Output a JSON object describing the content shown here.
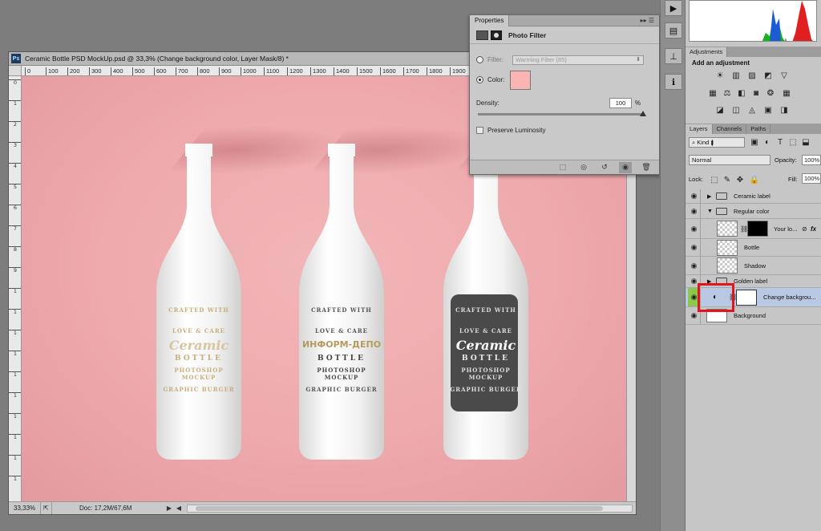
{
  "document": {
    "title": "Ceramic Bottle PSD MockUp.psd @ 33,3% (Change background color, Layer Mask/8) *",
    "ruler_ticks": [
      "0",
      "100",
      "200",
      "300",
      "400",
      "500",
      "600",
      "700",
      "800",
      "900",
      "1000",
      "1100",
      "1200",
      "1300",
      "1400",
      "1500",
      "1600",
      "1700",
      "1800",
      "1900",
      "200"
    ],
    "zoom": "33,33%",
    "doc_info": "Doc: 17,2M/67,6M"
  },
  "bottles": [
    {
      "line1": "CRAFTED WITH",
      "line2": "LOVE & CARE",
      "main": "Ceramic",
      "mid": "BOTTLE",
      "sub1": "PHOTOSHOP",
      "sub2": "MOCKUP",
      "footer": "GRAPHIC BURGER"
    },
    {
      "line1": "CRAFTED WITH",
      "line2": "LOVE & CARE",
      "main": "ИНФОРМ-ДЕПО",
      "mid": "BOTTLE",
      "sub1": "PHOTOSHOP",
      "sub2": "MOCKUP",
      "footer": "GRAPHIC BURGER"
    },
    {
      "line1": "CRAFTED WITH",
      "line2": "LOVE & CARE",
      "main": "Ceramic",
      "mid": "BOTTLE",
      "sub1": "PHOTOSHOP",
      "sub2": "MOCKUP",
      "footer": "GRAPHIC BURGER"
    }
  ],
  "properties": {
    "tab": "Properties",
    "header": "Photo Filter",
    "filter_label": "Filter:",
    "filter_value": "Warming Filter (85)",
    "color_label": "Color:",
    "color": "#fab4b4",
    "density_label": "Density:",
    "density_value": "100",
    "density_unit": "%",
    "preserve_label": "Preserve Luminosity"
  },
  "adjustments": {
    "tab": "Adjustments",
    "title": "Add an adjustment"
  },
  "layers_panel": {
    "tabs": [
      "Layers",
      "Channels",
      "Paths"
    ],
    "kind": "Kind",
    "blend_mode": "Normal",
    "opacity_label": "Opacity:",
    "opacity_value": "100%",
    "lock_label": "Lock:",
    "fill_label": "Fill:",
    "fill_value": "100%",
    "layers": [
      {
        "name": "Ceramic label"
      },
      {
        "name": "Regular color"
      },
      {
        "name": "Your lo..."
      },
      {
        "name": "Bottle"
      },
      {
        "name": "Shadow"
      },
      {
        "name": "Golden label"
      },
      {
        "name": "Change backgrou..."
      },
      {
        "name": "Background"
      }
    ]
  },
  "colors": {
    "canvas_bg": "#eea9ac",
    "highlight": "#e0161c",
    "selected_layer": "#b9c8e3"
  }
}
